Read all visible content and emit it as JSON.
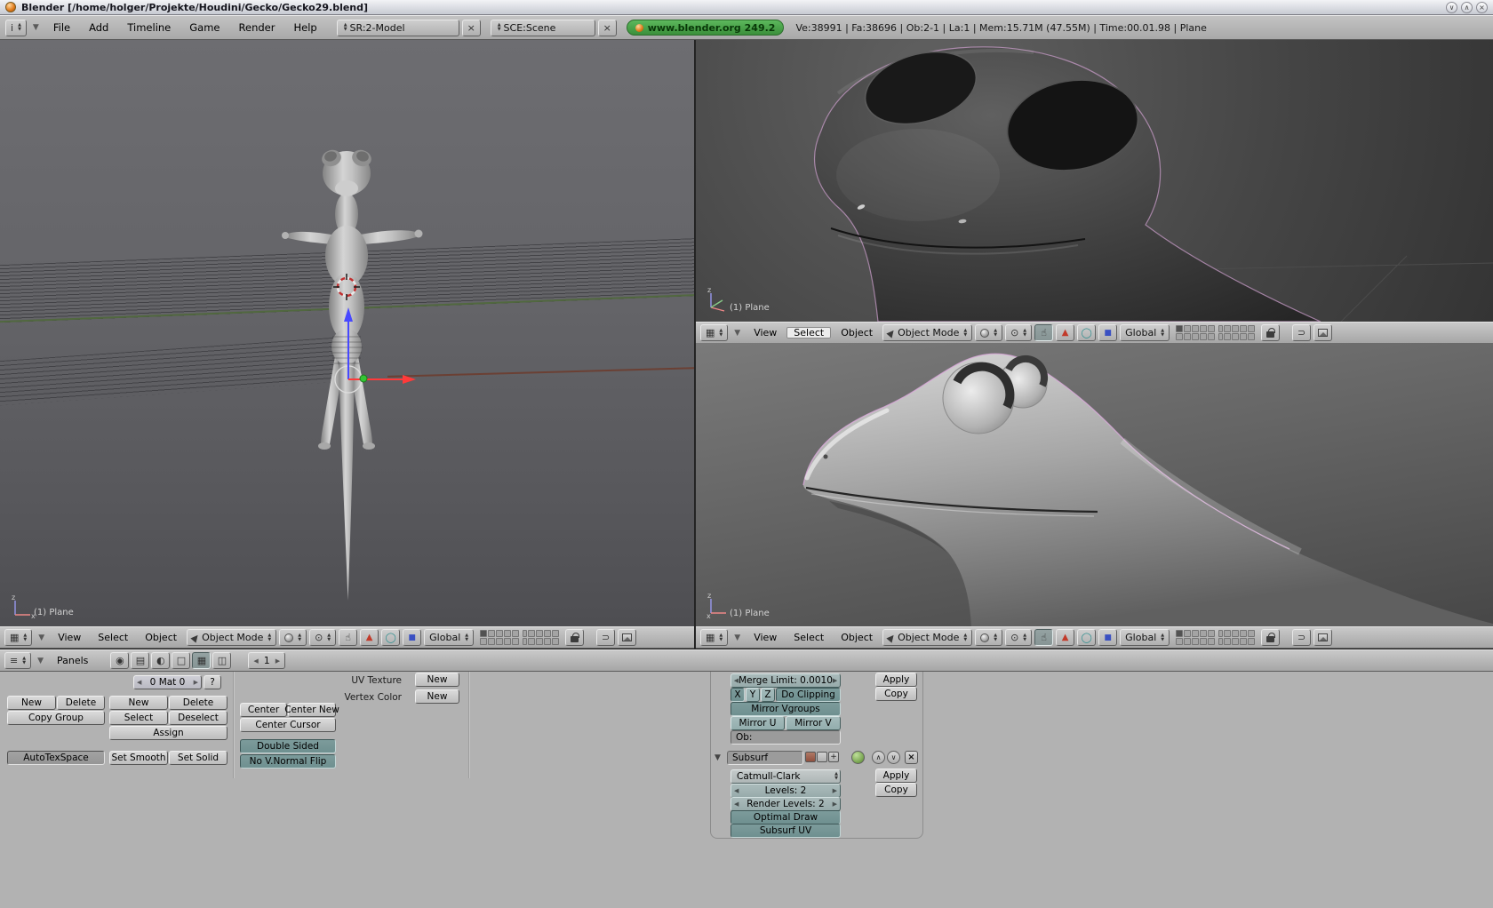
{
  "window": {
    "title": "Blender [/home/holger/Projekte/Houdini/Gecko/Gecko29.blend]"
  },
  "menubar": {
    "menus": [
      "File",
      "Add",
      "Timeline",
      "Game",
      "Render",
      "Help"
    ],
    "screen": "SR:2-Model",
    "scene": "SCE:Scene",
    "version": "www.blender.org 249.2",
    "stats": "Ve:38991 | Fa:38696 | Ob:2-1 | La:1 | Mem:15.71M (47.55M) | Time:00.01.98 | Plane"
  },
  "viewport_header": {
    "view": "View",
    "select": "Select",
    "object": "Object",
    "mode": "Object Mode",
    "orientation": "Global",
    "active_layer": 1
  },
  "viewports": {
    "left_label": "(1) Plane",
    "top_right_label": "(1) Plane",
    "bottom_right_label": "(1) Plane"
  },
  "buttons_header": {
    "panels": "Panels",
    "frame": "1"
  },
  "panels": {
    "material_browse": "0 Mat 0",
    "material_help": "?",
    "link": {
      "new": "New",
      "delete": "Delete",
      "copy_group": "Copy Group",
      "autotexspace": "AutoTexSpace"
    },
    "vgroup": {
      "new": "New",
      "delete": "Delete",
      "select": "Select",
      "deselect": "Deselect",
      "assign": "Assign"
    },
    "smooth": {
      "set_smooth": "Set Smooth",
      "set_solid": "Set Solid"
    },
    "center": {
      "center": "Center",
      "center_new": "Center New",
      "center_cursor": "Center Cursor"
    },
    "mesh": {
      "double_sided": "Double Sided",
      "no_vnormal_flip": "No V.Normal Flip",
      "uv_texture": "UV Texture",
      "uv_new": "New",
      "vertex_color": "Vertex Color",
      "vcol_new": "New"
    }
  },
  "modifiers": {
    "mirror": {
      "merge_limit": "Merge Limit: 0.0010",
      "axis_x": "X",
      "axis_y": "Y",
      "axis_z": "Z",
      "do_clipping": "Do Clipping",
      "mirror_vgroups": "Mirror Vgroups",
      "mirror_u": "Mirror U",
      "mirror_v": "Mirror V",
      "ob": "Ob:",
      "apply": "Apply",
      "copy": "Copy"
    },
    "subsurf": {
      "name": "Subsurf",
      "type": "Catmull-Clark",
      "levels": "Levels: 2",
      "render_levels": "Render Levels: 2",
      "optimal_draw": "Optimal Draw",
      "subsurf_uv": "Subsurf UV",
      "apply": "Apply",
      "copy": "Copy"
    }
  },
  "icons": {
    "info": "i",
    "grid": "▦",
    "menu_lines": "≡",
    "close": "×",
    "hand": "☝",
    "translate": "▲",
    "rotate": "◯",
    "scale": "■",
    "pivot": "⊙",
    "magnet": "⊃",
    "plus": "+",
    "up_circle": "∧",
    "down_circle": "∨",
    "logic": "◉",
    "script": "▤",
    "shading": "◐",
    "object_ctx": "□",
    "editing_ctx": "▦",
    "scene_ctx": "◫",
    "stepper_left": "◀",
    "stepper_right": "▶",
    "win_shade": "∨",
    "win_max": "∧"
  },
  "colors": {
    "toggle_on": "#6f9090",
    "toggle_off": "#93aeae",
    "badge_green": "#3b8f3b",
    "selection_outline": "#d9a6d9",
    "axis_x": "#ff3a3a",
    "axis_z": "#4848ff",
    "cursor_red": "#c03030"
  }
}
